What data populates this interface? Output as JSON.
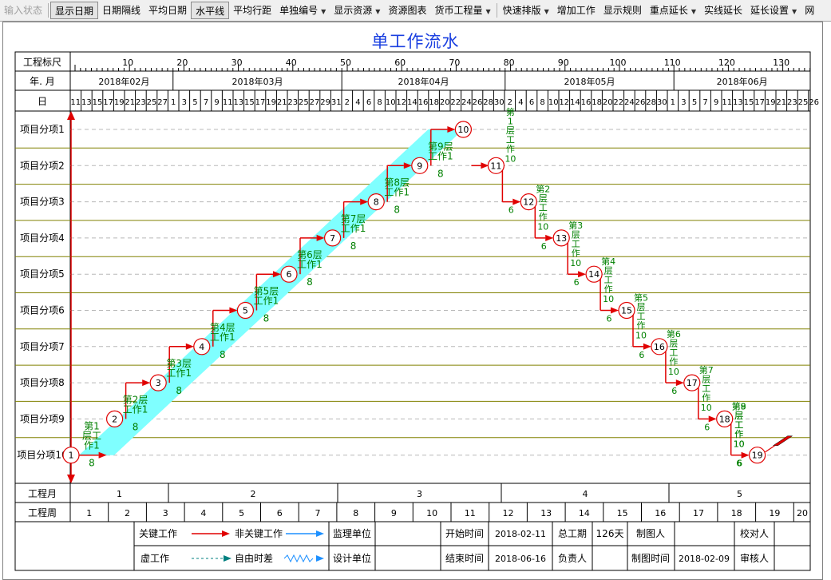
{
  "toolbar": {
    "items": [
      {
        "label": "输入状态",
        "state": "disabled",
        "dropdown": false
      },
      {
        "label": "显示日期",
        "state": "pressed",
        "dropdown": false
      },
      {
        "label": "日期隔线",
        "state": "normal",
        "dropdown": false
      },
      {
        "label": "平均日期",
        "state": "normal",
        "dropdown": false
      },
      {
        "label": "水平线",
        "state": "pressed",
        "dropdown": false
      },
      {
        "label": "平均行距",
        "state": "normal",
        "dropdown": false
      },
      {
        "label": "单独编号",
        "state": "normal",
        "dropdown": true
      },
      {
        "label": "显示资源",
        "state": "normal",
        "dropdown": true
      },
      {
        "label": "资源图表",
        "state": "normal",
        "dropdown": false
      },
      {
        "label": "货币工程量",
        "state": "normal",
        "dropdown": true
      },
      {
        "label": "快速排版",
        "state": "normal",
        "dropdown": true
      },
      {
        "label": "增加工作",
        "state": "normal",
        "dropdown": false
      },
      {
        "label": "显示规则",
        "state": "normal",
        "dropdown": false
      },
      {
        "label": "重点延长",
        "state": "normal",
        "dropdown": true
      },
      {
        "label": "实线延长",
        "state": "normal",
        "dropdown": false
      },
      {
        "label": "延长设置",
        "state": "normal",
        "dropdown": true
      },
      {
        "label": "网",
        "state": "normal",
        "dropdown": false
      }
    ],
    "dropdown_glyph": "▼"
  },
  "title": "单工作流水",
  "colors": {
    "accent_title": "#1a3fe0",
    "band": "#7fffff",
    "critical": "#e00000",
    "label_green": "#008000",
    "grid": "#808000",
    "arrow_blue": "#1e90ff",
    "dash_teal": "#008080"
  },
  "header": {
    "labels": {
      "scale": "工程标尺",
      "yearmonth": "年. 月",
      "day": "日"
    },
    "scale_ticks": [
      "10",
      "20",
      "30",
      "40",
      "50",
      "60",
      "70",
      "80",
      "90",
      "100",
      "110",
      "120",
      "130"
    ],
    "months": [
      "2018年02月",
      "2018年03月",
      "2018年04月",
      "2018年05月",
      "2018年06月"
    ],
    "days": [
      "11",
      "13",
      "15",
      "17",
      "19",
      "21",
      "23",
      "25",
      "27",
      "1",
      "3",
      "5",
      "7",
      "9",
      "11",
      "13",
      "15",
      "17",
      "19",
      "21",
      "23",
      "25",
      "27",
      "29",
      "31",
      "2",
      "4",
      "6",
      "8",
      "10",
      "12",
      "14",
      "16",
      "18",
      "20",
      "22",
      "24",
      "26",
      "28",
      "30",
      "2",
      "4",
      "6",
      "8",
      "10",
      "12",
      "14",
      "16",
      "18",
      "20",
      "22",
      "24",
      "26",
      "28",
      "30",
      "1",
      "3",
      "5",
      "7",
      "9",
      "11",
      "13",
      "15",
      "17",
      "19",
      "21",
      "23",
      "25",
      "26"
    ]
  },
  "rows": [
    "项目分项1",
    "项目分项2",
    "项目分项3",
    "项目分项4",
    "项目分项5",
    "项目分项6",
    "项目分项7",
    "项目分项8",
    "项目分项9",
    "项目分项10"
  ],
  "bottom": {
    "month_label": "工程月",
    "months": [
      "1",
      "2",
      "3",
      "4",
      "5"
    ],
    "week_label": "工程周",
    "weeks": [
      "1",
      "2",
      "3",
      "4",
      "5",
      "6",
      "7",
      "8",
      "9",
      "10",
      "11",
      "12",
      "13",
      "14",
      "15",
      "16",
      "17",
      "18",
      "19",
      "20"
    ]
  },
  "legend": {
    "key_work": "关键工作",
    "nonkey_work": "非关键工作",
    "supervisor": "监理单位",
    "dummy_work": "虚工作",
    "free_float": "自由时差",
    "designer": "设计单位",
    "start_label": "开始时间",
    "start_value": "2018-02-11",
    "end_label": "结束时间",
    "end_value": "2018-06-16",
    "duration_label": "总工期",
    "duration_value": "126天",
    "owner_label": "负责人",
    "owner_value": "",
    "drafter_label": "制图人",
    "drafter_value": "",
    "drawtime_label": "制图时间",
    "drawtime_value": "2018-02-09",
    "checker_label": "校对人",
    "reviewer_label": "审核人"
  },
  "network": {
    "nodes": [
      "1",
      "2",
      "3",
      "4",
      "5",
      "6",
      "7",
      "8",
      "9",
      "10",
      "11",
      "12",
      "13",
      "14",
      "15",
      "16",
      "17",
      "18",
      "19"
    ],
    "rising": [
      {
        "label": "第1层工作1",
        "short": [
          "第1",
          "层工",
          "作1"
        ],
        "dur": "8"
      },
      {
        "label": "第2层工作1",
        "short": [
          "第2层",
          "工作1"
        ],
        "dur": "8"
      },
      {
        "label": "第3层工作1",
        "short": [
          "第3层",
          "工作1"
        ],
        "dur": "8"
      },
      {
        "label": "第4层工作1",
        "short": [
          "第4层",
          "工作1"
        ],
        "dur": "8"
      },
      {
        "label": "第5层工作1",
        "short": [
          "第5层",
          "工作1"
        ],
        "dur": "8"
      },
      {
        "label": "第6层工作1",
        "short": [
          "第6层",
          "工作1"
        ],
        "dur": "8"
      },
      {
        "label": "第7层工作1",
        "short": [
          "第7层",
          "工作1"
        ],
        "dur": "8"
      },
      {
        "label": "第8层工作1",
        "short": [
          "第8层",
          "工作1"
        ],
        "dur": "8"
      },
      {
        "label": "第9层工作1",
        "short": [
          "第9层",
          "工作1"
        ],
        "dur": "8"
      }
    ],
    "falling": [
      {
        "chars": [
          "第",
          "1",
          "层",
          "工",
          "作"
        ],
        "dur": "10",
        "lag": "6"
      },
      {
        "chars": [
          "第2",
          "层",
          "工",
          "作"
        ],
        "dur": "10",
        "lag": "6"
      },
      {
        "chars": [
          "第3",
          "层",
          "工",
          "作"
        ],
        "dur": "10",
        "lag": "6"
      },
      {
        "chars": [
          "第4",
          "层",
          "工",
          "作"
        ],
        "dur": "10",
        "lag": "6"
      },
      {
        "chars": [
          "第5",
          "层",
          "工",
          "作"
        ],
        "dur": "10",
        "lag": "6"
      },
      {
        "chars": [
          "第6",
          "层",
          "工",
          "作"
        ],
        "dur": "10",
        "lag": "6"
      },
      {
        "chars": [
          "第7",
          "层",
          "工",
          "作"
        ],
        "dur": "10",
        "lag": "6"
      },
      {
        "chars": [
          "第8",
          "层",
          "工",
          "作"
        ],
        "dur": "10",
        "lag": "6"
      },
      {
        "chars": [
          "第9",
          "层",
          "工",
          "作"
        ],
        "dur": "10",
        "lag": "6"
      }
    ]
  }
}
